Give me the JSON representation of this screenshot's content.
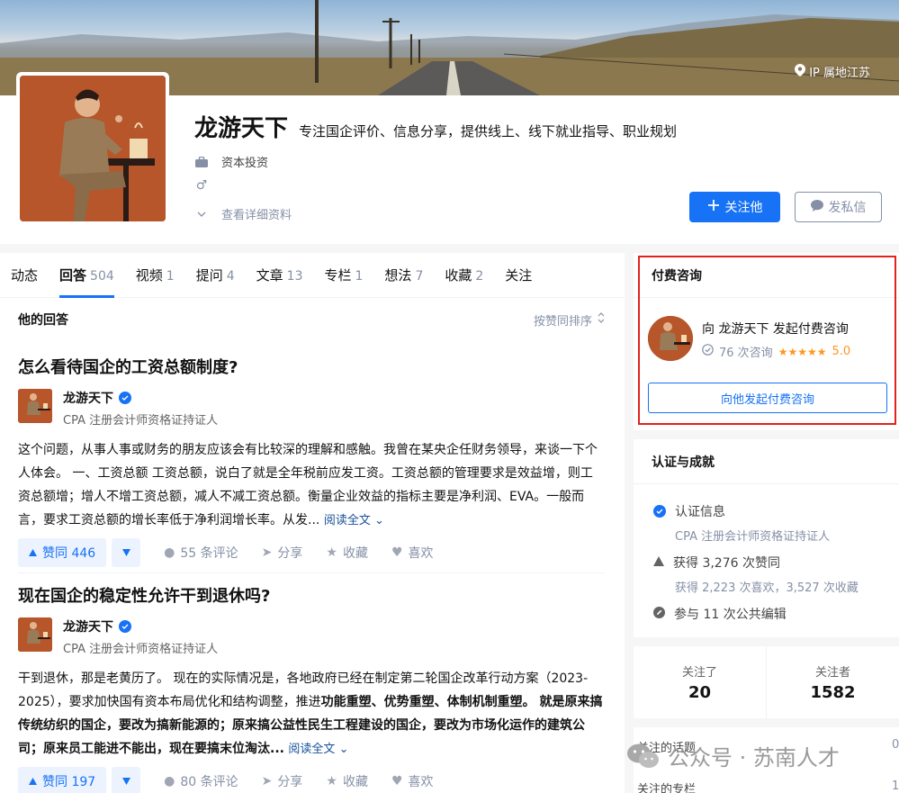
{
  "banner": {
    "ip_location": "IP 属地江苏"
  },
  "profile": {
    "name": "龙游天下",
    "headline": "专注国企评价、信息分享，提供线上、线下就业指导、职业规划",
    "industry": "资本投资",
    "gender_symbol": "♂",
    "detail_link": "查看详细资料",
    "follow_button": "关注他",
    "message_button": "发私信"
  },
  "tabs": [
    {
      "label": "动态",
      "count": ""
    },
    {
      "label": "回答",
      "count": "504"
    },
    {
      "label": "视频",
      "count": "1"
    },
    {
      "label": "提问",
      "count": "4"
    },
    {
      "label": "文章",
      "count": "13"
    },
    {
      "label": "专栏",
      "count": "1"
    },
    {
      "label": "想法",
      "count": "7"
    },
    {
      "label": "收藏",
      "count": "2"
    },
    {
      "label": "关注",
      "count": ""
    }
  ],
  "list": {
    "title": "他的回答",
    "sort": "按赞同排序"
  },
  "answers": [
    {
      "question": "怎么看待国企的工资总额制度?",
      "author": "龙游天下",
      "badge": "CPA 注册会计师资格证持证人",
      "excerpt": "这个问题，从事人事或财务的朋友应该会有比较深的理解和感触。我曾在某央企任财务领导，来谈一下个人体会。 一、工资总额 工资总额，说白了就是全年税前应发工资。工资总额的管理要求是效益增，则工资总额增；增人不增工资总额，减人不减工资总额。衡量企业效益的指标主要是净利润、EVA。一般而言，要求工资总额的增长率低于净利润增长率。从发...",
      "read_more": "阅读全文",
      "votes": "赞同 446",
      "comments": "55 条评论",
      "share": "分享",
      "collect": "收藏",
      "like": "喜欢"
    },
    {
      "question": "现在国企的稳定性允许干到退休吗?",
      "author": "龙游天下",
      "badge": "CPA 注册会计师资格证持证人",
      "excerpt_plain": "干到退休，那是老黄历了。 现在的实际情况是，各地政府已经在制定第二轮国企改革行动方案（2023-2025），要求加快国有资本布局优化和结构调整，推进",
      "excerpt_bold": "功能重塑、优势重塑、体制机制重塑。 就是原来搞传统纺织的国企，要改为搞新能源的；原来搞公益性民生工程建设的国企，要改为市场化运作的建筑公司；原来员工能进不能出，现在要搞末位淘汰...",
      "read_more": "阅读全文",
      "votes": "赞同 197",
      "comments": "80 条评论",
      "share": "分享",
      "collect": "收藏",
      "like": "喜欢"
    }
  ],
  "consult": {
    "title": "付费咨询",
    "line1": "向 龙游天下 发起付费咨询",
    "count": "76 次咨询",
    "stars": "★★★★★",
    "score": "5.0",
    "button": "向他发起付费咨询"
  },
  "achievements": {
    "title": "认证与成就",
    "cert_label": "认证信息",
    "cert_value": "CPA 注册会计师资格证持证人",
    "votes": "获得 3,276 次赞同",
    "votes_sub": "获得 2,223 次喜欢，3,527 次收藏",
    "edits": "参与 11 次公共编辑"
  },
  "follow_stats": {
    "following_label": "关注了",
    "following": "20",
    "followers_label": "关注者",
    "followers": "1582"
  },
  "bottom_links": [
    {
      "label": "关注的话题",
      "count": "0"
    },
    {
      "label": "关注的专栏",
      "count": "1"
    }
  ],
  "watermark": "公众号 · 苏南人才",
  "colors": {
    "accent": "#1772f6",
    "highlight_border": "#e3221f",
    "star": "#ff961e"
  }
}
